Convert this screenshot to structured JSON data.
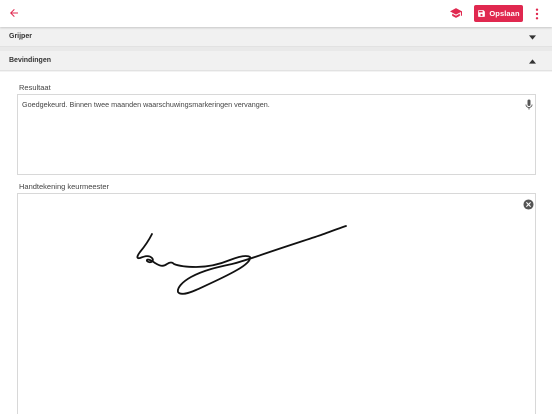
{
  "toolbar": {
    "back_icon": "arrow-left-icon",
    "school_icon": "graduation-cap-icon",
    "save_icon": "floppy-disk-icon",
    "save_label": "Opslaan",
    "menu_icon": "more-vertical-icon",
    "accent_color": "#e0284f"
  },
  "sections": {
    "grijper": {
      "title": "Grijper",
      "expanded": false
    },
    "bevindingen": {
      "title": "Bevindingen",
      "expanded": true
    }
  },
  "form": {
    "resultaat": {
      "label": "Resultaat",
      "value": "Goedgekeurd. Binnen twee maanden waarschuwingsmarkeringen vervangen.",
      "icon": "microphone-icon"
    },
    "handtekening": {
      "label": "Handtekening keurmeester",
      "clear_icon": "close-circle-icon"
    }
  }
}
